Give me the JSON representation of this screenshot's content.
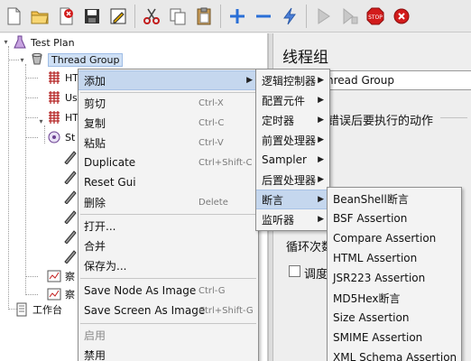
{
  "toolbar": {
    "buttons": [
      "new-file-icon",
      "open-folder-icon",
      "close-file-icon",
      "save-icon",
      "edit-icon",
      "cut-icon",
      "copy-icon",
      "paste-icon",
      "expand-icon",
      "collapse-icon",
      "toggle-icon",
      "start-icon",
      "start-no-pause-icon",
      "stop-icon",
      "shutdown-icon"
    ],
    "colors": {
      "plus": "#2a6fd6",
      "stop": "#d21b1b",
      "shutdown": "#d21b1b",
      "green": "#6aa84f"
    }
  },
  "tree": {
    "test_plan": "Test Plan",
    "thread_group": "Thread Group",
    "children": [
      "HT",
      "Us",
      "HT",
      "St"
    ],
    "partial_bottom": [
      "察",
      "察"
    ],
    "workbench": "工作台"
  },
  "right_panel": {
    "title": "线程组",
    "name_value": "hread Group",
    "error_action_label": "错误后要执行的动作",
    "loop_label": "循环次数",
    "scheduler_label": "调度"
  },
  "context_menu": {
    "items": [
      {
        "label": "添加",
        "accel": "",
        "submenu": true
      },
      {
        "label": "剪切",
        "accel": "Ctrl-X"
      },
      {
        "label": "复制",
        "accel": "Ctrl-C"
      },
      {
        "label": "粘贴",
        "accel": "Ctrl-V"
      },
      {
        "label": "Duplicate",
        "accel": "Ctrl+Shift-C"
      },
      {
        "label": "Reset Gui",
        "accel": ""
      },
      {
        "label": "删除",
        "accel": "Delete"
      },
      {
        "label": "打开...",
        "accel": ""
      },
      {
        "label": "合并",
        "accel": ""
      },
      {
        "label": "保存为...",
        "accel": ""
      },
      {
        "label": "Save Node As Image",
        "accel": "Ctrl-G"
      },
      {
        "label": "Save Screen As Image",
        "accel": "Ctrl+Shift-G"
      },
      {
        "label": "启用",
        "accel": ""
      },
      {
        "label": "禁用",
        "accel": ""
      }
    ]
  },
  "add_submenu": {
    "items": [
      "逻辑控制器",
      "配置元件",
      "定时器",
      "前置处理器",
      "Sampler",
      "后置处理器",
      "断言",
      "监听器"
    ]
  },
  "assertion_submenu": {
    "items": [
      "BeanShell断言",
      "BSF Assertion",
      "Compare Assertion",
      "HTML Assertion",
      "JSR223 Assertion",
      "MD5Hex断言",
      "Size Assertion",
      "SMIME Assertion",
      "XML Schema Assertion"
    ]
  }
}
